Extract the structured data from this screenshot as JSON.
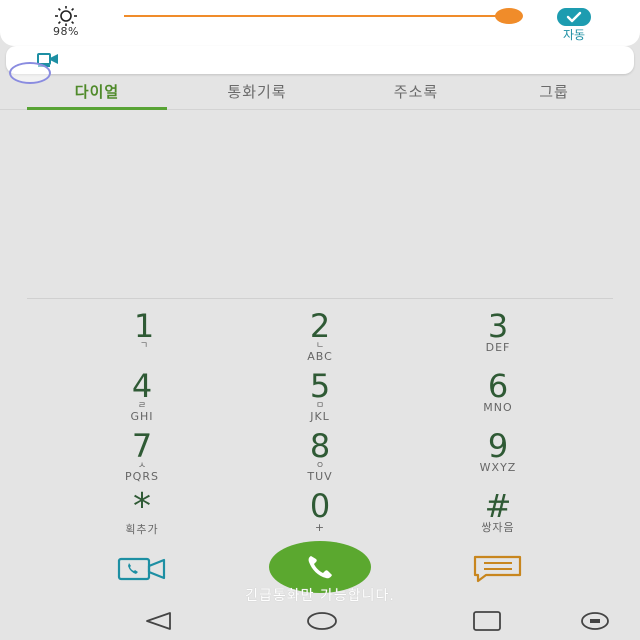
{
  "quick_panel": {
    "brightness_percent_label": "98%",
    "brightness_level": 0.98,
    "auto_label": "자동",
    "accent_color": "#f08c2a",
    "auto_color": "#1d9cb0"
  },
  "notification": {
    "icon": "video-call-icon"
  },
  "tabs": [
    {
      "label": "다이얼",
      "active": true
    },
    {
      "label": "통화기록",
      "active": false
    },
    {
      "label": "주소록",
      "active": false
    },
    {
      "label": "그룹",
      "active": false
    }
  ],
  "keypad": {
    "k1": {
      "digit": "1",
      "jamo": "ㄱ",
      "letters": ""
    },
    "k2": {
      "digit": "2",
      "jamo": "ㄴ",
      "letters": "ABC"
    },
    "k3": {
      "digit": "3",
      "jamo": "",
      "letters": "DEF"
    },
    "k4": {
      "digit": "4",
      "jamo": "ㄹ",
      "letters": "GHI"
    },
    "k5": {
      "digit": "5",
      "jamo": "ㅁ",
      "letters": "JKL"
    },
    "k6": {
      "digit": "6",
      "jamo": "",
      "letters": "MNO"
    },
    "k7": {
      "digit": "7",
      "jamo": "ㅅ",
      "letters": "PQRS"
    },
    "k8": {
      "digit": "8",
      "jamo": "ㅇ",
      "letters": "TUV"
    },
    "k9": {
      "digit": "9",
      "jamo": "",
      "letters": "WXYZ"
    },
    "kstar": {
      "digit": "*",
      "jamo": "",
      "letters": "획추가"
    },
    "k0": {
      "digit": "0",
      "jamo": "",
      "letters": "+"
    },
    "khash": {
      "digit": "#",
      "jamo": "",
      "letters": "쌍자음"
    }
  },
  "actions": {
    "video_call_icon": "video-call-icon",
    "call_icon": "phone-icon",
    "message_icon": "message-icon",
    "emergency_text": "긴급통화만 가능합니다.",
    "call_color": "#5ba82f"
  },
  "nav": {
    "back": "back-icon",
    "home": "home-icon",
    "recents": "recents-icon",
    "extra": "dual-window-icon"
  }
}
